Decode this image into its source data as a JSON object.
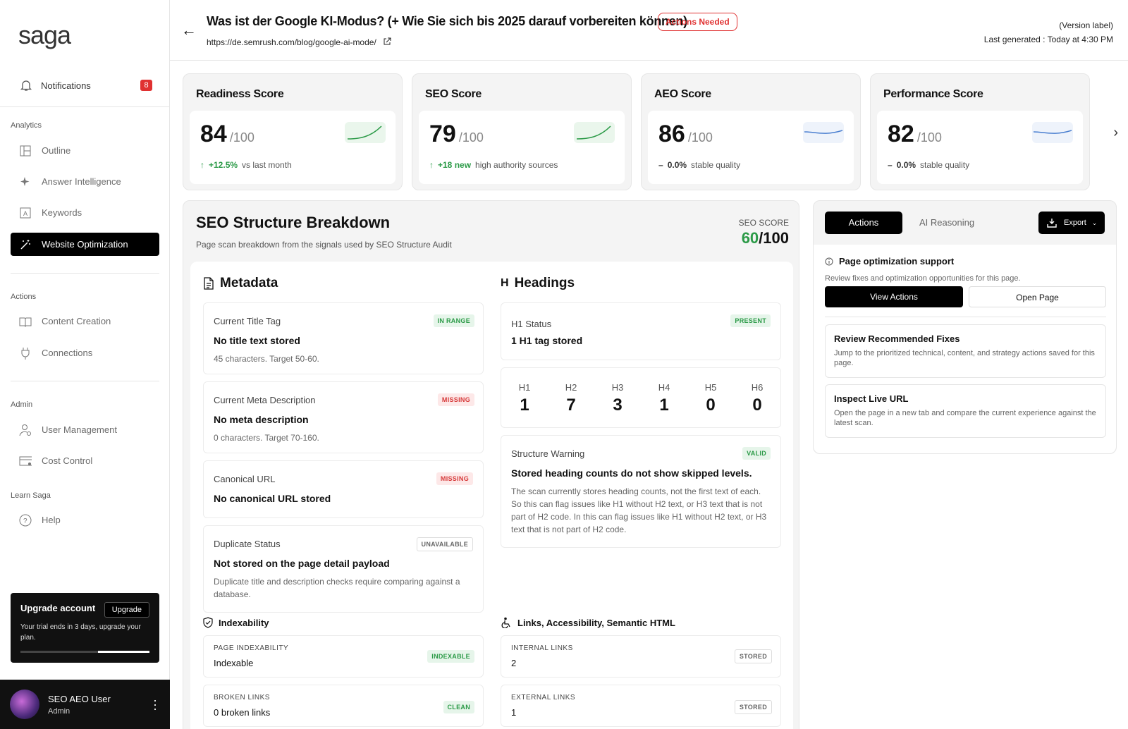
{
  "sidebar": {
    "brand": "saga",
    "notifications": {
      "label": "Notifications",
      "count": "8"
    },
    "sections": {
      "analytics": "Analytics",
      "actions": "Actions",
      "admin": "Admin",
      "learn": "Learn Saga"
    },
    "items": [
      {
        "label": "Outline",
        "icon": "layout-icon"
      },
      {
        "label": "Answer Intelligence",
        "icon": "sparkle-icon"
      },
      {
        "label": "Keywords",
        "icon": "keyword-icon"
      },
      {
        "label": "Website Optimization",
        "icon": "magic-wand-icon",
        "active": true
      },
      {
        "label": "Content Creation",
        "icon": "book-icon"
      },
      {
        "label": "Connections",
        "icon": "plug-icon"
      },
      {
        "label": "User Management",
        "icon": "user-gear-icon"
      },
      {
        "label": "Cost Control",
        "icon": "credit-card-icon"
      },
      {
        "label": "Help",
        "icon": "help-icon"
      }
    ],
    "upgrade": {
      "title": "Upgrade account",
      "button": "Upgrade",
      "desc": "Your trial ends in 3 days, upgrade your plan.",
      "progress": 0.4
    },
    "user": {
      "name": "SEO AEO User",
      "role": "Admin"
    }
  },
  "header": {
    "title": "Was ist der Google KI-Modus? (+ Wie Sie sich bis 2025 darauf vorbereiten können)",
    "status": "Actions Needed",
    "url": "https://de.semrush.com/blog/google-ai-mode/",
    "version_label": "(Version label)",
    "last_generated": "Last generated : Today at 4:30 PM"
  },
  "scores": [
    {
      "title": "Readiness Score",
      "value": "84",
      "of": "/100",
      "delta": "+12.5%",
      "note": "vs last month",
      "trend": "up"
    },
    {
      "title": "SEO Score",
      "value": "79",
      "of": "/100",
      "delta": "+18 new",
      "note": "high authority sources",
      "trend": "up"
    },
    {
      "title": "AEO Score",
      "value": "86",
      "of": "/100",
      "delta": "0.0%",
      "note": "stable quality",
      "trend": "flat"
    },
    {
      "title": "Performance Score",
      "value": "82",
      "of": "/100",
      "delta": "0.0%",
      "note": "stable quality",
      "trend": "flat"
    }
  ],
  "breakdown": {
    "title": "SEO Structure Breakdown",
    "subtitle": "Page scan breakdown from the signals used by SEO Structure Audit",
    "score_label": "SEO SCORE",
    "score_value": "60",
    "score_of": "/100",
    "metadata": {
      "title": "Metadata",
      "items": [
        {
          "label": "Current Title Tag",
          "value": "No title text stored",
          "note": "45 characters. Target 50-60.",
          "tag": "IN RANGE"
        },
        {
          "label": "Current Meta Description",
          "value": "No meta description",
          "note": "0 characters. Target 70-160.",
          "tag": "MISSING"
        },
        {
          "label": "Canonical URL",
          "value": "No canonical URL stored",
          "tag": "MISSING"
        },
        {
          "label": "Duplicate Status",
          "value": "Not stored on the page detail payload",
          "note": "Duplicate title and description checks require comparing against a database.",
          "tag": "UNAVAILABLE"
        }
      ]
    },
    "headings": {
      "title": "Headings",
      "h_glyph": "H",
      "status": {
        "label": "H1 Status",
        "value": "1 H1 tag stored",
        "tag": "PRESENT"
      },
      "counts": [
        {
          "k": "H1",
          "v": "1"
        },
        {
          "k": "H2",
          "v": "7"
        },
        {
          "k": "H3",
          "v": "3"
        },
        {
          "k": "H4",
          "v": "1"
        },
        {
          "k": "H5",
          "v": "0"
        },
        {
          "k": "H6",
          "v": "0"
        }
      ],
      "warning": {
        "label": "Structure Warning",
        "value": "Stored heading counts do not show skipped levels.",
        "note": "The scan currently stores heading counts, not the first text of each. So this can flag issues like H1 without H2 text, or H3 text that is not part of H2 code. In this can flag issues like H1 without H2 text, or H3 text that is not part of H2 code.",
        "tag": "VALID"
      }
    },
    "indexability": {
      "title": "Indexability",
      "items": [
        {
          "label": "PAGE INDEXABILITY",
          "value": "Indexable",
          "tag": "INDEXABLE"
        },
        {
          "label": "BROKEN LINKS",
          "value": "0 broken links",
          "tag": "CLEAN"
        }
      ]
    },
    "links": {
      "title": "Links, Accessibility, Semantic HTML",
      "items": [
        {
          "label": "INTERNAL LINKS",
          "value": "2",
          "tag": "STORED"
        },
        {
          "label": "EXTERNAL LINKS",
          "value": "1",
          "tag": "STORED"
        }
      ]
    }
  },
  "right": {
    "tab_active": "Actions",
    "tab_other": "AI Reasoning",
    "export": "Export",
    "heading": "Page optimization support",
    "desc": "Review fixes and optimization opportunities for this page.",
    "btn_primary": "View Actions",
    "btn_secondary": "Open Page",
    "cards": [
      {
        "title": "Review Recommended Fixes",
        "desc": "Jump to the prioritized technical, content, and strategy actions saved for this page."
      },
      {
        "title": "Inspect Live URL",
        "desc": "Open the page in a new tab and compare the current experience against the latest scan."
      }
    ]
  },
  "colors": {
    "green": "#2b9a47",
    "red": "#e03131",
    "black": "#000000"
  }
}
